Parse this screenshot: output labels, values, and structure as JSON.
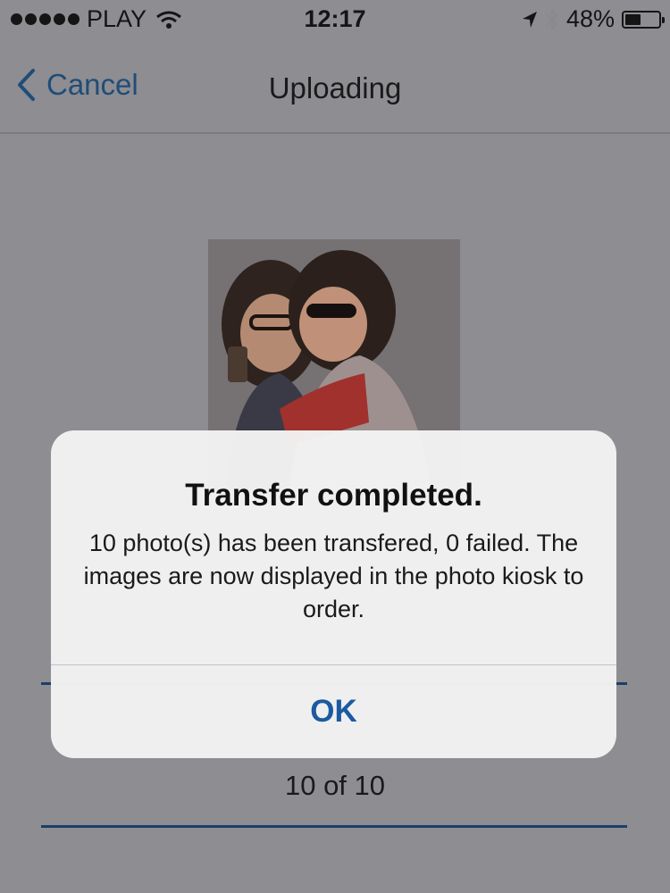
{
  "status_bar": {
    "carrier": "PLAY",
    "time": "12:17",
    "battery_text": "48%",
    "battery_level": 0.48,
    "icons": [
      "signal-dots-icon",
      "wifi-icon",
      "location-arrow-icon",
      "bluetooth-icon",
      "battery-icon"
    ]
  },
  "nav": {
    "back_label": "Cancel",
    "title": "Uploading",
    "back_icon": "chevron-left-icon"
  },
  "progress": {
    "label": "10 of 10"
  },
  "alert": {
    "title": "Transfer completed.",
    "message": "10 photo(s) has been transfered, 0 failed. The images are now displayed in the photo kiosk to order.",
    "ok_label": "OK"
  },
  "colors": {
    "accent": "#1b5aa0",
    "background_dimmed": "#8e8d92",
    "progress_line": "#1c3f66"
  }
}
